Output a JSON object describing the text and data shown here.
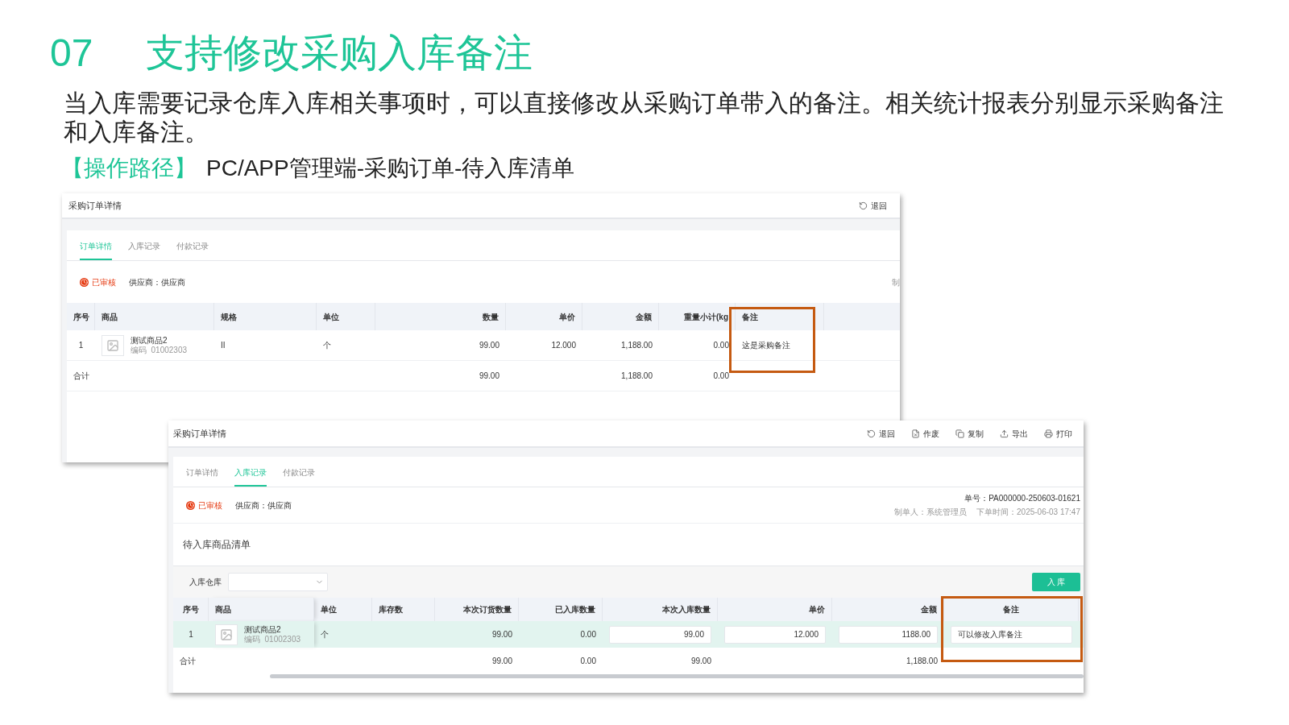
{
  "slide": {
    "number": "07",
    "title": "支持修改采购入库备注",
    "description": "当入库需要记录仓库入库相关事项时，可以直接修改从采购订单带入的备注。相关统计报表分别显示采购备注和入库备注。",
    "path_label": "【操作路径】",
    "path": "PC/APP管理端-采购订单-待入库清单"
  },
  "order_screen": {
    "title": "采购订单详情",
    "actions": [
      {
        "kind": "back",
        "label": "退回"
      }
    ],
    "tabs": [
      {
        "label": "订单详情",
        "selected": true
      },
      {
        "label": "入库记录",
        "selected": false
      },
      {
        "label": "付款记录",
        "selected": false
      }
    ],
    "status": "已审核",
    "supplier": "供应商：供应商",
    "edge_text": "制",
    "columns": [
      "序号",
      "商品",
      "规格",
      "单位",
      "数量",
      "单价",
      "金额",
      "重量小计(kg",
      "备注"
    ],
    "rows": [
      {
        "index": "1",
        "product": "测试商品2",
        "code": "编码  01002303",
        "spec": "II",
        "unit": "个",
        "quantity": "99.00",
        "price": "12.000",
        "amount": "1,188.00",
        "weight": "0.00",
        "remark": "这是采购备注"
      }
    ],
    "total": {
      "label": "合计",
      "quantity": "99.00",
      "amount": "1,188.00",
      "weight": "0.00"
    }
  },
  "receipt_screen": {
    "title": "采购订单详情",
    "actions": [
      {
        "kind": "back",
        "label": "退回"
      },
      {
        "kind": "void",
        "label": "作废"
      },
      {
        "kind": "copy",
        "label": "复制"
      },
      {
        "kind": "export",
        "label": "导出"
      },
      {
        "kind": "print",
        "label": "打印"
      }
    ],
    "tabs": [
      {
        "label": "订单详情",
        "selected": false
      },
      {
        "label": "入库记录",
        "selected": true
      },
      {
        "label": "付款记录",
        "selected": false
      }
    ],
    "status": "已审核",
    "supplier": "供应商：供应商",
    "order_no": "单号：PA000000-250603-01621",
    "creator": "制单人：系统管理员",
    "order_time": "下单时间：2025-06-03 17:47",
    "section_title": "待入库商品清单",
    "warehouse_label": "入库仓库",
    "submit_button": "入 库",
    "columns": [
      "序号",
      "商品",
      "单位",
      "库存数",
      "本次订货数量",
      "已入库数量",
      "本次入库数量",
      "单价",
      "金额",
      "备注"
    ],
    "rows": [
      {
        "index": "1",
        "product": "测试商品2",
        "code": "编码  01002303",
        "unit": "个",
        "ordered": "99.00",
        "received": "0.00",
        "receive_now": "99.00",
        "price": "12.000",
        "amount": "1188.00",
        "remark": "可以修改入库备注",
        "selected": true
      }
    ],
    "total": {
      "label": "合计",
      "ordered": "99.00",
      "received": "0.00",
      "receive_now": "99.00",
      "amount": "1,188.00"
    }
  }
}
